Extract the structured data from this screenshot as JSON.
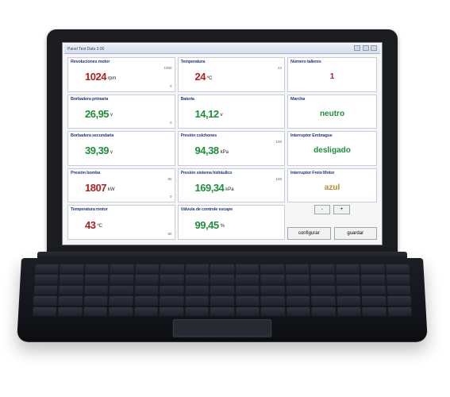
{
  "window": {
    "title": "Panel Test Data 3.00"
  },
  "panels": {
    "rpm": {
      "title": "Revoluciones motor",
      "value": "1024",
      "unit": "rpm",
      "color": "red",
      "tick_hi": "1000",
      "tick_lo": "0"
    },
    "temp": {
      "title": "Temperatura",
      "value": "24",
      "unit": "ºC",
      "color": "red",
      "tick_hi": "24",
      "tick_lo": ""
    },
    "turns": {
      "title": "Número talleres",
      "value": "1",
      "color": "red"
    },
    "pinP": {
      "title": "Borbadera primaria",
      "value": "26,95",
      "unit": "v",
      "color": "green",
      "tick_hi": "",
      "tick_lo": "0"
    },
    "bat": {
      "title": "Batería",
      "value": "14,12",
      "unit": "v",
      "color": "green",
      "tick_hi": "",
      "tick_lo": ""
    },
    "marcha": {
      "title": "Marcha",
      "value": "neutro",
      "color": "green"
    },
    "pinS": {
      "title": "Borbadera secundaria",
      "value": "39,39",
      "unit": "v",
      "color": "green",
      "tick_hi": "",
      "tick_lo": ""
    },
    "pColchon": {
      "title": "Presión colchones",
      "value": "94,38",
      "unit": "kPa",
      "color": "green",
      "tick_hi": "100",
      "tick_lo": ""
    },
    "intEmb": {
      "title": "Interruptor Embrague",
      "value": "desligado",
      "color": "green"
    },
    "pBomb": {
      "title": "Presión bomba",
      "value": "1807",
      "unit": "kW",
      "color": "red",
      "tick_hi": "80",
      "tick_lo": "0"
    },
    "pHidr": {
      "title": "Presión sistema hidráulico",
      "value": "169,34",
      "unit": "kPa",
      "color": "green",
      "tick_hi": "100",
      "tick_lo": ""
    },
    "intFM": {
      "title": "Interruptor Freio Motor",
      "value": "azul",
      "color": "gold"
    },
    "tMotor": {
      "title": "Temperatura motor",
      "value": "43",
      "unit": "ºC",
      "color": "red",
      "tick_hi": "",
      "tick_lo": "80"
    },
    "valv": {
      "title": "Válvula de controle escape",
      "value": "99,45",
      "unit": "%",
      "color": "green",
      "tick_hi": "",
      "tick_lo": ""
    }
  },
  "controls": {
    "minus": "-",
    "plus": "+",
    "configurar": "configurar",
    "guardar": "guardar"
  }
}
